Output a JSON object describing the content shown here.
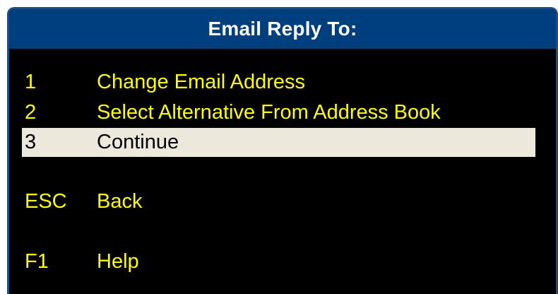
{
  "window": {
    "title": "Email Reply To:"
  },
  "menu": {
    "items": [
      {
        "key": "1",
        "label": "Change Email Address"
      },
      {
        "key": "2",
        "label": "Select Alternative From Address Book"
      },
      {
        "key": "3",
        "label": "Continue"
      }
    ],
    "esc": {
      "key": "ESC",
      "label": "Back"
    },
    "f1": {
      "key": "F1",
      "label": "Help"
    }
  },
  "colors": {
    "titlebar": "#003f7d",
    "background": "#000000",
    "text": "#ffff00",
    "selected_bg": "#ece8dc",
    "selected_text": "#000000"
  }
}
